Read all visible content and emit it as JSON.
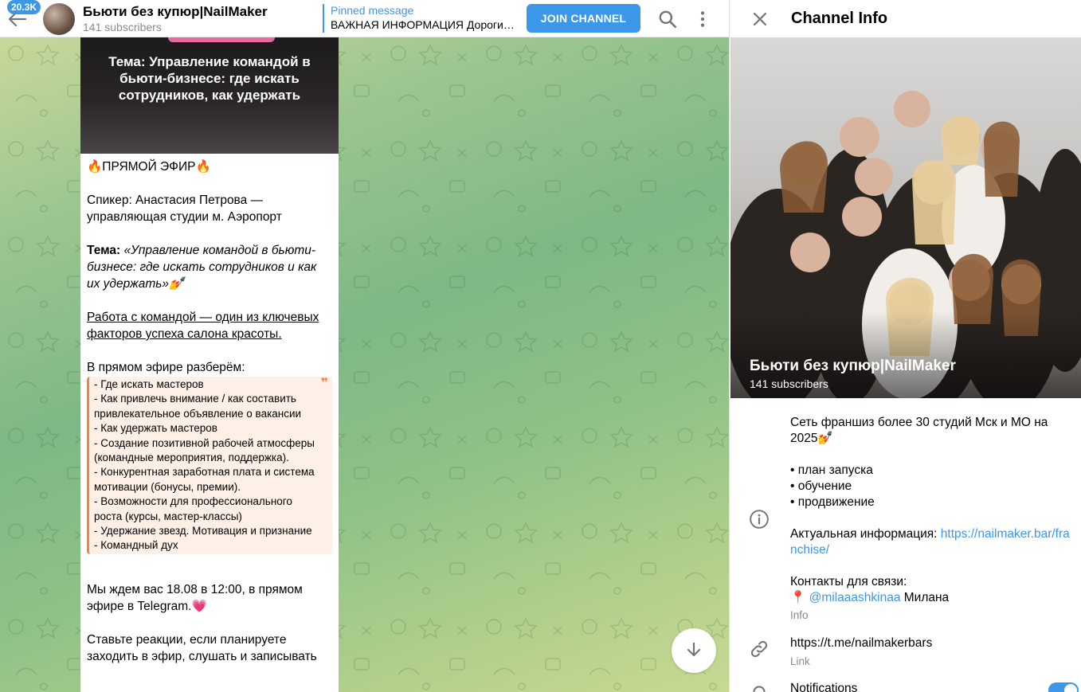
{
  "header": {
    "unread_count": "20.3K",
    "title": "Бьюти без купюр|NailMaker",
    "subtitle": "141 subscribers",
    "pinned_title": "Pinned message",
    "pinned_text": "ВАЖНАЯ ИНФОРМАЦИЯ Дорогие …",
    "join_label": "JOIN CHANNEL",
    "icons": [
      "back-arrow-icon",
      "search-icon",
      "more-vertical-icon"
    ]
  },
  "message": {
    "image_text": "Тема: Управление командой в бьюти-бизнесе: где искать сотрудников, как удержать",
    "headline": "🔥ПРЯМОЙ ЭФИР🔥",
    "speaker": "Спикер: Анастасия Петрова — управляющая студии м. Аэропорт",
    "topic_label": "Тема:",
    "topic_text": "«Управление командой в бьюти-бизнесе: где искать сотрудников и как их удержать»💅",
    "team_text": "Работа с командой — один из ключевых факторов успеха салона красоты.",
    "agenda_intro": "В прямом эфире разберём:",
    "agenda_items": [
      "- Где искать мастеров",
      "- Как привлечь внимание / как составить привлекательное объявление о вакансии",
      "- Как удержать мастеров",
      "- Создание позитивной рабочей атмосферы (командные мероприятия, поддержка).",
      "- Конкурентная заработная плата и система мотивации (бонусы, премии).",
      "- Возможности для профессионального роста (курсы, мастер-классы)",
      "- Удержание звезд. Мотивация и признание",
      "- Командный дух"
    ],
    "quote_mark": "❞",
    "invite": "Мы ждем вас 18.08 в 12:00, в прямом эфире в Telegram.💗",
    "react": "Ставьте реакции, если планируете заходить в эфир, слушать и записывать"
  },
  "info_panel": {
    "title": "Channel Info",
    "channel_name": "Бьюти без купюр|NailMaker",
    "subscribers": "141 subscribers",
    "description_line1": "Сеть франшиз более 30 студий Мск и МО на 2025💅",
    "bullets": [
      "• план запуска",
      "• обучение",
      "• продвижение"
    ],
    "actual_label": "Актуальная информация: ",
    "actual_link": "https://nailmaker.bar/franchise/",
    "contacts_label": "Контакты для связи:",
    "contact_pin": "📍",
    "contact_handle": "@milaaashkinaa",
    "contact_name": " Милана",
    "info_caption": "Info",
    "link_value": "https://t.me/nailmakerbars",
    "link_caption": "Link",
    "notifications_label": "Notifications",
    "notifications_on": true,
    "icons": [
      "close-icon",
      "info-icon",
      "link-icon",
      "bell-icon"
    ]
  },
  "colors": {
    "accent": "#3d97e8",
    "quote_border": "#f3843a",
    "quote_bg": "#fef0e7"
  }
}
